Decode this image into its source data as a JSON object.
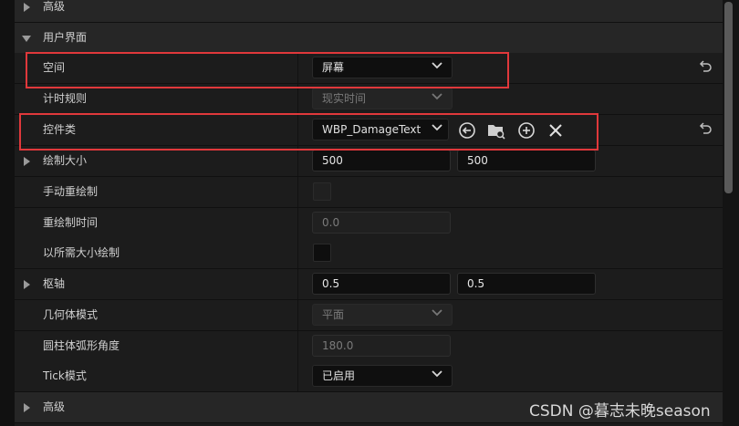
{
  "rows": {
    "advanced_top": {
      "label": "高级"
    },
    "user_interface": {
      "label": "用户界面"
    },
    "space": {
      "label": "空间",
      "value": "屏幕"
    },
    "timing_policy": {
      "label": "计时规则",
      "value": "现实时间"
    },
    "widget_class": {
      "label": "控件类",
      "value": "WBP_DamageText"
    },
    "draw_size": {
      "label": "绘制大小",
      "x": "500",
      "y": "500"
    },
    "manual_redraw": {
      "label": "手动重绘制"
    },
    "redraw_time": {
      "label": "重绘制时间",
      "value": "0.0"
    },
    "draw_at_desired_size": {
      "label": "以所需大小绘制"
    },
    "pivot": {
      "label": "枢轴",
      "x": "0.5",
      "y": "0.5"
    },
    "geometry_mode": {
      "label": "几何体模式",
      "value": "平面"
    },
    "cylinder_arc_angle": {
      "label": "圆柱体弧形角度",
      "value": "180.0"
    },
    "tick_mode": {
      "label": "Tick模式",
      "value": "已启用"
    },
    "advanced_bottom": {
      "label": "高级"
    }
  },
  "icons": {
    "reset": "reset-to-default-arrow",
    "use_selected": "arrow-left-circle",
    "browse": "folder-search",
    "add": "plus-circle",
    "clear": "x-cross"
  },
  "colors": {
    "highlight": "#e0383b",
    "panel_bg": "#1c1c1c",
    "field_bg": "#0f0f0f"
  },
  "watermark": "CSDN @暮志未晚season"
}
